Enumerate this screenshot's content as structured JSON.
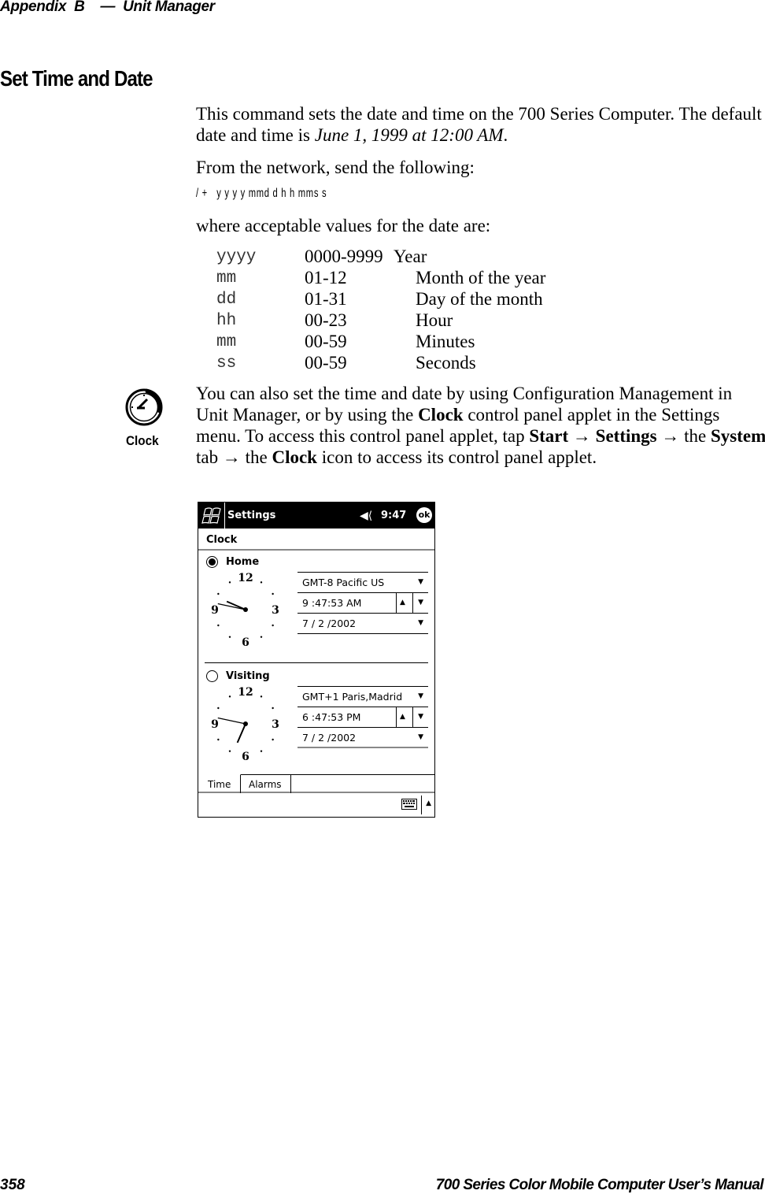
{
  "header": {
    "appendix": "Appendix  B",
    "dash": "—",
    "chapter": "Unit Manager"
  },
  "section": {
    "title": "Set Time and Date"
  },
  "paragraphs": {
    "intro_1": "This command sets the date and time on the 700 Series Computer. The default date and time is ",
    "intro_default": "June 1, 1999 at 12:00 AM",
    "intro_end": ".",
    "network": "From the network, send the following:",
    "command": "/ +   y y y y mmd d h h mms s",
    "where": "where acceptable values for the date are:"
  },
  "values_table": [
    {
      "code": "yyyy",
      "range": "0000-9999",
      "desc": "Year"
    },
    {
      "code": "mm",
      "range": "01-12",
      "desc": "Month of the year"
    },
    {
      "code": "dd",
      "range": "01-31",
      "desc": "Day of the month"
    },
    {
      "code": "hh",
      "range": "00-23",
      "desc": "Hour"
    },
    {
      "code": "mm",
      "range": "00-59",
      "desc": "Minutes"
    },
    {
      "code": "ss",
      "range": "00-59",
      "desc": "Seconds"
    }
  ],
  "note": {
    "icon_label": "Clock",
    "t1": "You can also set the time and date by using Configuration Management in Unit Manager, or by using the ",
    "b1": "Clock",
    "t2": " control panel applet in the Settings menu. To access this control panel applet, tap ",
    "b2": "Start",
    "arrow": " → ",
    "b3": "Settings",
    "t3": " the ",
    "b4": "System",
    "t4": " tab ",
    "t5": " the ",
    "b5": "Clock",
    "t6": " icon to access its control panel applet."
  },
  "device": {
    "nav_title": "Settings",
    "speaker_icon": "speaker-muted-icon",
    "time": "9:47",
    "ok_label": "ok",
    "section": "Clock",
    "zones": [
      {
        "name": "Home",
        "selected": true,
        "timezone": "GMT-8 Pacific US",
        "time": "9 :47:53 AM",
        "date": "7 / 2 /2002",
        "clock": {
          "hour": 9,
          "minute": 47
        },
        "numerals": [
          "12",
          "3",
          "6",
          "9"
        ]
      },
      {
        "name": "Visiting",
        "selected": false,
        "timezone": "GMT+1 Paris,Madrid",
        "time": "6 :47:53 PM",
        "date": "7 / 2 /2002",
        "clock": {
          "hour": 6,
          "minute": 47
        },
        "numerals": [
          "12",
          "3",
          "6",
          "9"
        ]
      }
    ],
    "tabs": [
      "Time",
      "Alarms"
    ],
    "active_tab": "Time"
  },
  "footer": {
    "page_number": "358",
    "manual_title": "700 Series Color Mobile Computer User’s Manual"
  }
}
